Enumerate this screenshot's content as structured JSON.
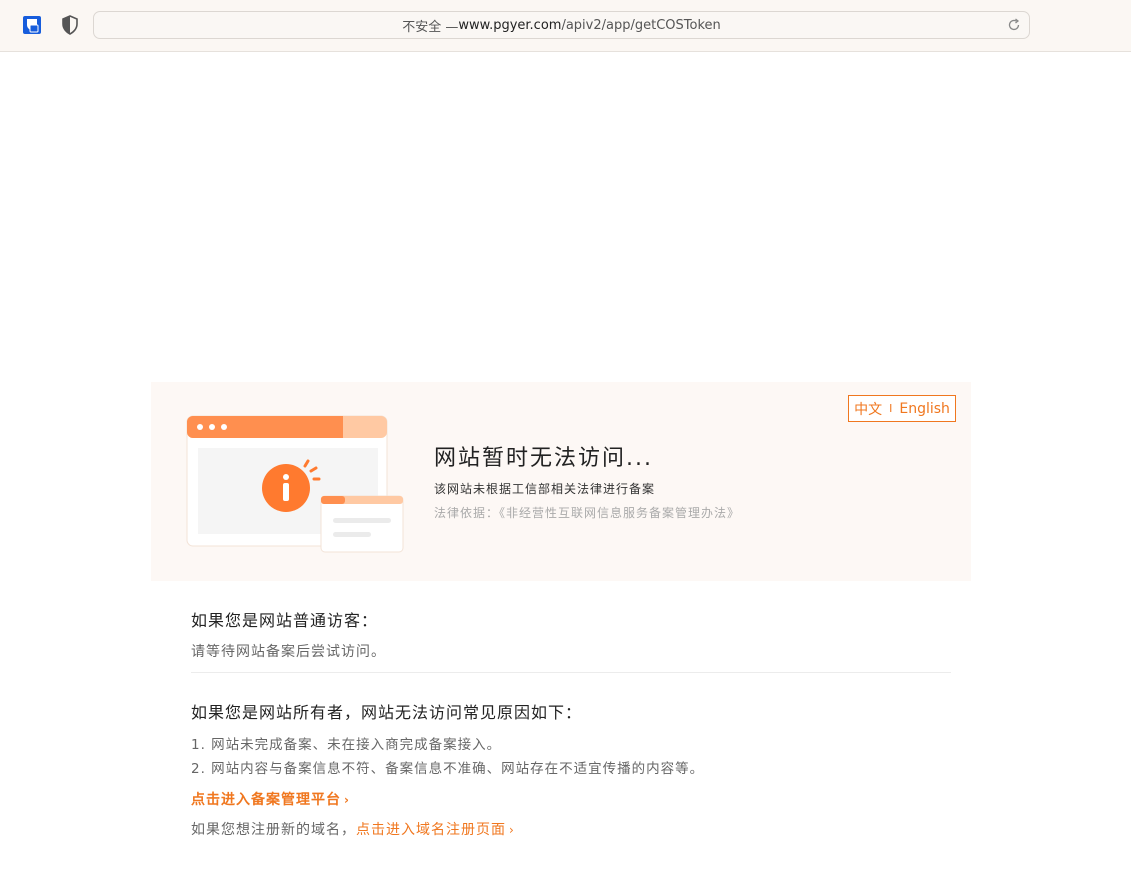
{
  "browser": {
    "url_prefix": "不安全 — ",
    "url_host": "www.pgyer.com",
    "url_path": "/apiv2/app/getCOSToken"
  },
  "banner": {
    "lang_zh": "中文",
    "lang_sep": "I",
    "lang_en": "English",
    "headline": "网站暂时无法访问...",
    "subline": "该网站未根据工信部相关法律进行备案",
    "lawline": "法律依据：《非经营性互联网信息服务备案管理办法》"
  },
  "visitor": {
    "title": "如果您是网站普通访客：",
    "text": "请等待网站备案后尝试访问。"
  },
  "owner": {
    "title": "如果您是网站所有者，网站无法访问常见原因如下：",
    "reasons": [
      "1. 网站未完成备案、未在接入商完成备案接入。",
      "2. 网站内容与备案信息不符、备案信息不准确、网站存在不适宜传播的内容等。"
    ],
    "platform_link": "点击进入备案管理平台",
    "domain_prompt": "如果您想注册新的域名，",
    "domain_link": "点击进入域名注册页面"
  },
  "colors": {
    "accent": "#f0771f",
    "banner_bg": "#fdf8f5"
  },
  "icons": [
    "bitwarden-icon",
    "shield-icon",
    "reload-icon",
    "info-illustration",
    "chevron-right-icon"
  ]
}
